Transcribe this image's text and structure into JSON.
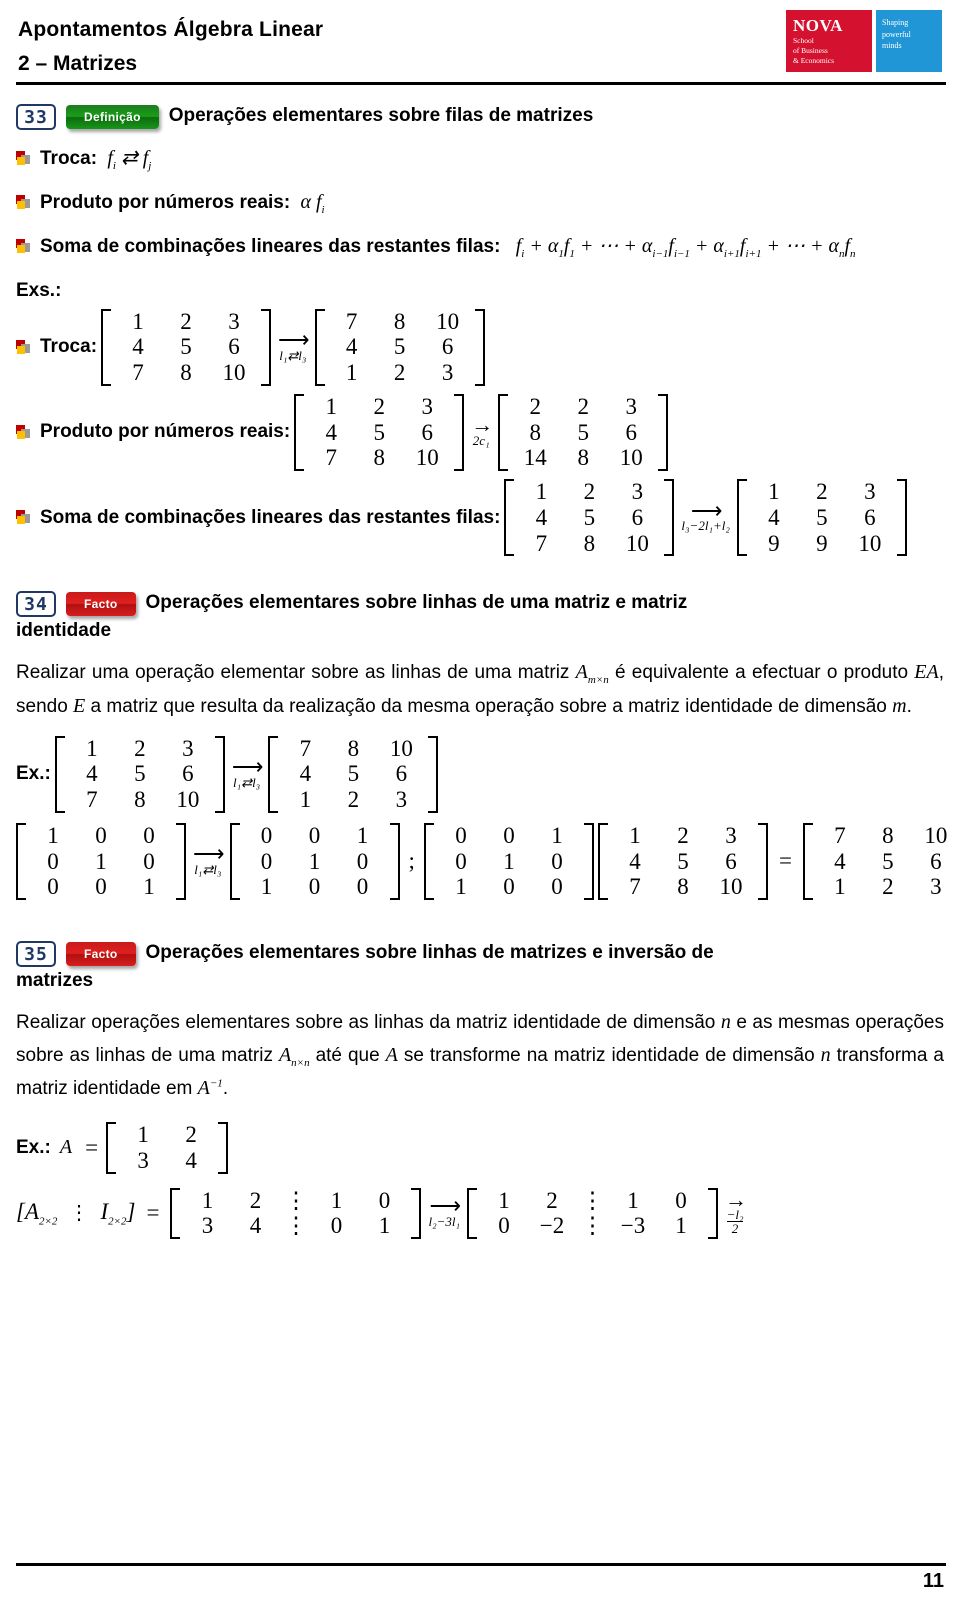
{
  "header": {
    "title": "Apontamentos Álgebra Linear",
    "subtitle": "2 – Matrizes",
    "logo": {
      "name": "NOVA",
      "school": "School\nof Business\n& Economics",
      "tagline": "Shaping\npowerful\nminds",
      "red": "#d51130",
      "blue": "#2196d6"
    }
  },
  "footer": {
    "page_number": "11"
  },
  "sections": [
    {
      "number": "33",
      "badge": "Definição",
      "badge_color": "#18a018",
      "title": "Operações elementares sobre filas de matrizes",
      "bullets": [
        {
          "label": "Troca:",
          "formula": "f_i ⇄ f_j"
        },
        {
          "label": "Produto por números reais:",
          "formula": "α f_i"
        },
        {
          "label": "Soma de combinações lineares das restantes filas:",
          "formula": "f_i + α₁f₁ + ⋯ + α_{i−1}f_{i−1} + α_{i+1}f_{i+1} + ⋯ + α_n f_n"
        }
      ],
      "examples_label": "Exs.:",
      "examples": [
        {
          "label": "Troca:",
          "from": [
            [
              "1",
              "2",
              "3"
            ],
            [
              "4",
              "5",
              "6"
            ],
            [
              "7",
              "8",
              "10"
            ]
          ],
          "op": "l₁⇄l₃",
          "to": [
            [
              "7",
              "8",
              "10"
            ],
            [
              "4",
              "5",
              "6"
            ],
            [
              "1",
              "2",
              "3"
            ]
          ]
        },
        {
          "label": "Produto por números reais:",
          "from": [
            [
              "1",
              "2",
              "3"
            ],
            [
              "4",
              "5",
              "6"
            ],
            [
              "7",
              "8",
              "10"
            ]
          ],
          "op": "2c₁",
          "to": [
            [
              "2",
              "2",
              "3"
            ],
            [
              "8",
              "5",
              "6"
            ],
            [
              "14",
              "8",
              "10"
            ]
          ]
        },
        {
          "label": "Soma de combinações lineares das restantes filas:",
          "from": [
            [
              "1",
              "2",
              "3"
            ],
            [
              "4",
              "5",
              "6"
            ],
            [
              "7",
              "8",
              "10"
            ]
          ],
          "op": "l₃−2l₁+l₂",
          "to": [
            [
              "1",
              "2",
              "3"
            ],
            [
              "4",
              "5",
              "6"
            ],
            [
              "9",
              "9",
              "10"
            ]
          ]
        }
      ]
    },
    {
      "number": "34",
      "badge": "Facto",
      "badge_color": "#d81d1d",
      "title": "Operações elementares sobre linhas de uma matriz e matriz",
      "title_cont": "identidade",
      "body": "Realizar uma operação elementar sobre as linhas de uma matriz A_{m×n} é equivalente a efectuar o produto EA, sendo E a matriz que resulta da realização da mesma operação sobre a matriz identidade de dimensão m.",
      "example_label": "Ex.:",
      "example": {
        "from": [
          [
            "1",
            "2",
            "3"
          ],
          [
            "4",
            "5",
            "6"
          ],
          [
            "7",
            "8",
            "10"
          ]
        ],
        "op": "l₁⇄l₃",
        "to": [
          [
            "7",
            "8",
            "10"
          ],
          [
            "4",
            "5",
            "6"
          ],
          [
            "1",
            "2",
            "3"
          ]
        ]
      },
      "identity_line": {
        "identity": [
          [
            "1",
            "0",
            "0"
          ],
          [
            "0",
            "1",
            "0"
          ],
          [
            "0",
            "0",
            "1"
          ]
        ],
        "op": "l₁⇄l₃",
        "elementary": [
          [
            "0",
            "0",
            "1"
          ],
          [
            "0",
            "1",
            "0"
          ],
          [
            "1",
            "0",
            "0"
          ]
        ],
        "separator": ";",
        "product_left": [
          [
            "0",
            "0",
            "1"
          ],
          [
            "0",
            "1",
            "0"
          ],
          [
            "1",
            "0",
            "0"
          ]
        ],
        "product_right": [
          [
            "1",
            "2",
            "3"
          ],
          [
            "4",
            "5",
            "6"
          ],
          [
            "7",
            "8",
            "10"
          ]
        ],
        "equals": "=",
        "result": [
          [
            "7",
            "8",
            "10"
          ],
          [
            "4",
            "5",
            "6"
          ],
          [
            "1",
            "2",
            "3"
          ]
        ]
      }
    },
    {
      "number": "35",
      "badge": "Facto",
      "badge_color": "#d81d1d",
      "title": "Operações elementares sobre linhas de matrizes e inversão de",
      "title_cont": "matrizes",
      "body": "Realizar operações elementares sobre as linhas da matriz identidade de dimensão n e as mesmas operações sobre as linhas de uma matriz A_{n×n} até que A se transforme na matriz identidade de dimensão n transforma a matriz identidade em A⁻¹.",
      "example_label": "Ex.:",
      "example_matrix_name": "A",
      "example_equals": "=",
      "example_matrix": [
        [
          "1",
          "2"
        ],
        [
          "3",
          "4"
        ]
      ],
      "augmented": {
        "bracket_label_left": "[A",
        "bracket_label_left_sub": "2×2",
        "bracket_label_dots": "⋮",
        "bracket_label_right": "I",
        "bracket_label_right_sub": "2×2",
        "bracket_label_close": "]",
        "equals": "=",
        "start": [
          [
            "1",
            "2",
            "⋮",
            "1",
            "0"
          ],
          [
            "3",
            "4",
            "⋮",
            "0",
            "1"
          ]
        ],
        "op1": "l₂−3l₁",
        "mid": [
          [
            "1",
            "2",
            "⋮",
            "1",
            "0"
          ],
          [
            "0",
            "−2",
            "⋮",
            "−3",
            "1"
          ]
        ],
        "op2_num": "−l₂",
        "op2_den": "2"
      }
    }
  ]
}
